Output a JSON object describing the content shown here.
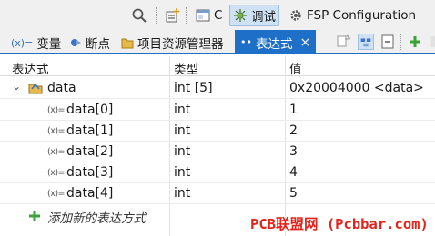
{
  "perspective_bar": {
    "perspectives": [
      {
        "label": "C",
        "icon": "c-perspective-icon"
      },
      {
        "label": "调试",
        "icon": "debug-perspective-icon",
        "active": true
      },
      {
        "label": "FSP Configuration",
        "icon": "gear-icon"
      }
    ]
  },
  "view_tabs": [
    {
      "label": "变量",
      "icon": "variables-icon"
    },
    {
      "label": "断点",
      "icon": "breakpoints-icon"
    },
    {
      "label": "项目资源管理器",
      "icon": "project-explorer-icon"
    },
    {
      "label": "表达式",
      "icon": "expressions-icon",
      "active": true,
      "close": "×"
    }
  ],
  "table": {
    "columns": [
      "表达式",
      "类型",
      "值"
    ],
    "rows": [
      {
        "expression": "data",
        "type": "int [5]",
        "value": "0x20004000 <data>",
        "expanded": true,
        "level": 0
      },
      {
        "expression": "data[0]",
        "type": "int",
        "value": "1",
        "level": 1
      },
      {
        "expression": "data[1]",
        "type": "int",
        "value": "2",
        "level": 1
      },
      {
        "expression": "data[2]",
        "type": "int",
        "value": "3",
        "level": 1
      },
      {
        "expression": "data[3]",
        "type": "int",
        "value": "4",
        "level": 1
      },
      {
        "expression": "data[4]",
        "type": "int",
        "value": "5",
        "level": 1
      }
    ],
    "add_new": "添加新的表达方式"
  },
  "watermark": "PCB联盟网 (Pcbbar.com)",
  "colors": {
    "accent": "#1e6fc7",
    "active_perspective_bg": "#cfe2f5",
    "watermark": "#e5231b",
    "add_icon": "#3aa335"
  }
}
